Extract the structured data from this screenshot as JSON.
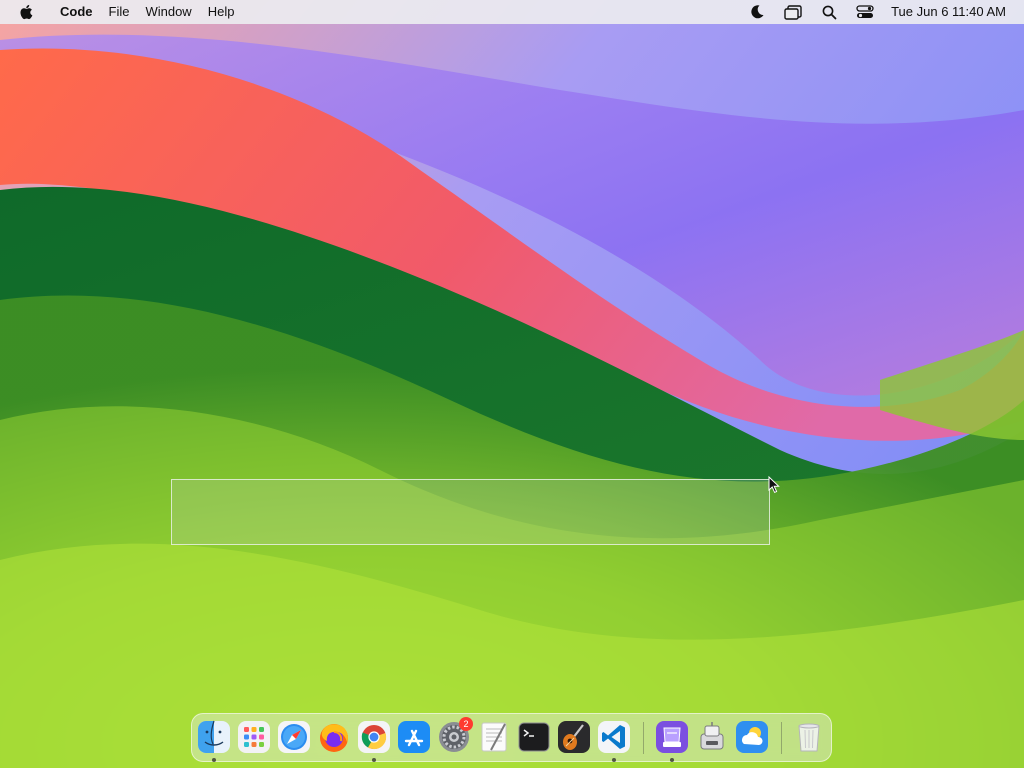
{
  "menubar": {
    "app_name": "Code",
    "menus": [
      "File",
      "Window",
      "Help"
    ],
    "clock": "Tue Jun 6  11:40 AM",
    "status_icons": [
      "moon-icon",
      "stage-manager-icon",
      "search-icon",
      "control-center-icon"
    ]
  },
  "dock": {
    "apps": [
      {
        "name": "Finder",
        "icon": "finder-icon",
        "running": true
      },
      {
        "name": "Launchpad",
        "icon": "launchpad-icon",
        "running": false
      },
      {
        "name": "Safari",
        "icon": "safari-icon",
        "running": false
      },
      {
        "name": "Firefox",
        "icon": "firefox-icon",
        "running": false
      },
      {
        "name": "Google Chrome",
        "icon": "chrome-icon",
        "running": true
      },
      {
        "name": "App Store",
        "icon": "app-store-icon",
        "running": false
      },
      {
        "name": "System Settings",
        "icon": "settings-icon",
        "running": false,
        "badge": "2"
      },
      {
        "name": "TextEdit",
        "icon": "textedit-icon",
        "running": false
      },
      {
        "name": "Terminal",
        "icon": "terminal-icon",
        "running": false
      },
      {
        "name": "GarageBand",
        "icon": "garageband-icon",
        "running": false
      },
      {
        "name": "Visual Studio Code",
        "icon": "vscode-icon",
        "running": true
      },
      {
        "name": "Simulator Archive",
        "icon": "archive-icon",
        "running": true
      },
      {
        "name": "Automator",
        "icon": "automator-icon",
        "running": false
      },
      {
        "name": "Weather",
        "icon": "weather-icon",
        "running": false
      },
      {
        "name": "Trash",
        "icon": "trash-icon",
        "running": false
      }
    ]
  },
  "colors": {
    "menubar_bg": "#ececf0",
    "badge": "#ff3b30",
    "wallpaper_green": "#5a9c2a",
    "wallpaper_red": "#f25a57",
    "wallpaper_purple": "#8f7bf5"
  }
}
